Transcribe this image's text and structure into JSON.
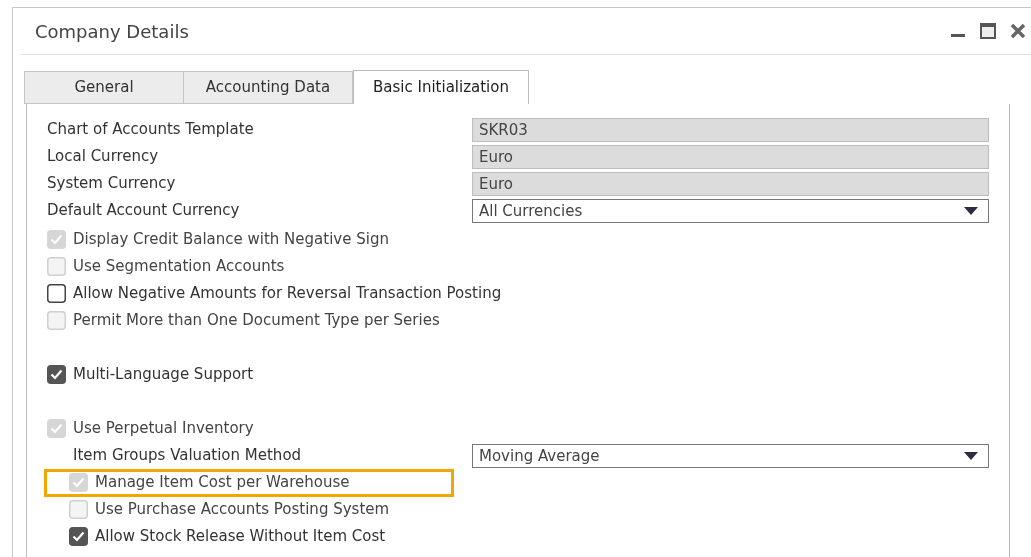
{
  "window": {
    "title": "Company Details"
  },
  "tabs": [
    {
      "label": "General",
      "selected": false
    },
    {
      "label": "Accounting Data",
      "selected": false
    },
    {
      "label": "Basic Initialization",
      "selected": true
    }
  ],
  "fields": [
    {
      "label": "Chart of Accounts Template",
      "value": "SKR03",
      "kind": "readonly"
    },
    {
      "label": "Local Currency",
      "value": "Euro",
      "kind": "readonly"
    },
    {
      "label": "System Currency",
      "value": "Euro",
      "kind": "readonly"
    },
    {
      "label": "Default Account Currency",
      "value": "All Currencies",
      "kind": "dropdown"
    }
  ],
  "option_groups": [
    [
      {
        "kind": "checkbox",
        "label": "Display Credit Balance with Negative Sign",
        "checked": true,
        "disabled": true
      },
      {
        "kind": "checkbox",
        "label": "Use Segmentation Accounts",
        "checked": false,
        "disabled": true
      },
      {
        "kind": "checkbox",
        "label": "Allow Negative Amounts for Reversal Transaction Posting",
        "checked": false,
        "disabled": false
      },
      {
        "kind": "checkbox",
        "label": "Permit More than One Document Type per Series",
        "checked": false,
        "disabled": true
      }
    ],
    [
      {
        "kind": "checkbox",
        "label": "Multi-Language Support",
        "checked": true,
        "disabled": false
      }
    ],
    [
      {
        "kind": "checkbox",
        "label": "Use Perpetual Inventory",
        "checked": true,
        "disabled": true,
        "children": [
          {
            "kind": "dropdown",
            "label": "Item Groups Valuation Method",
            "value": "Moving Average"
          },
          {
            "kind": "checkbox",
            "label": "Manage Item Cost per Warehouse",
            "checked": true,
            "disabled": true,
            "highlighted": true
          },
          {
            "kind": "checkbox",
            "label": "Use Purchase Accounts Posting System",
            "checked": false,
            "disabled": true
          },
          {
            "kind": "checkbox",
            "label": "Allow Stock Release Without Item Cost",
            "checked": true,
            "disabled": false
          }
        ]
      }
    ]
  ]
}
